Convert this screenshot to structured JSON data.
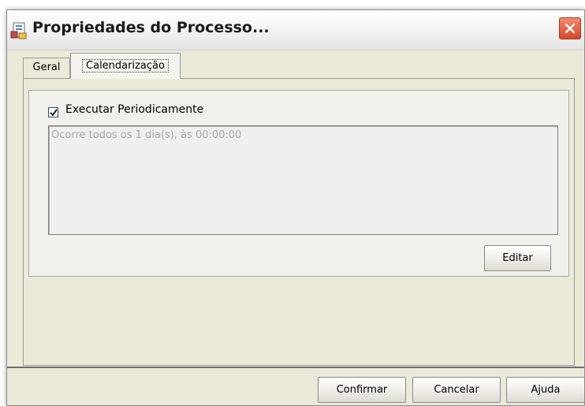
{
  "window": {
    "title": "Propriedades do Processo...",
    "accent": "#d8452a"
  },
  "tabs": [
    {
      "label": "Geral",
      "selected": false
    },
    {
      "label": "Calendarização",
      "selected": true
    }
  ],
  "schedule": {
    "checkbox_label": "Executar Periodicamente",
    "checked": true,
    "description": "Ocorre todos os 1 dia(s), às 00:00:00",
    "edit_label": "Editar"
  },
  "footer": {
    "confirm_label": "Confirmar",
    "cancel_label": "Cancelar",
    "help_label": "Ajuda"
  }
}
